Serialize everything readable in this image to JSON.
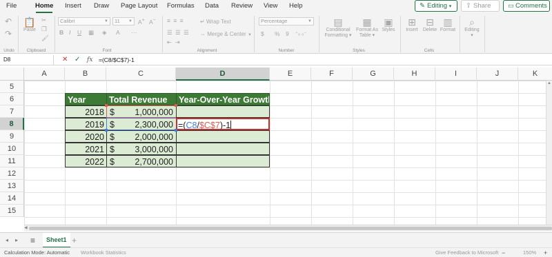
{
  "menu": {
    "items": [
      "File",
      "Home",
      "Insert",
      "Draw",
      "Page Layout",
      "Formulas",
      "Data",
      "Review",
      "View",
      "Help"
    ],
    "active": "Home",
    "editing_label": "Editing",
    "share_label": "Share",
    "comments_label": "Comments"
  },
  "ribbon": {
    "undo_label": "Undo",
    "clipboard": {
      "paste_label": "Paste",
      "group_label": "Clipboard"
    },
    "font": {
      "name": "Calibri",
      "size": "11",
      "group_label": "Font"
    },
    "alignment": {
      "wrap_label": "Wrap Text",
      "merge_label": "Merge & Center",
      "group_label": "Alignment"
    },
    "number": {
      "format": "Percentage",
      "group_label": "Number",
      "symbols": [
        "$",
        "%",
        "9"
      ]
    },
    "styles": {
      "conditional_label": "Conditional",
      "conditional_label2": "Formatting",
      "format_table_label": "Format As",
      "format_table_label2": "Table",
      "styles_label": "Styles",
      "group_label": "Styles"
    },
    "cells": {
      "insert_label": "Insert",
      "delete_label": "Delete",
      "format_label": "Format",
      "group_label": "Cells"
    },
    "editing": {
      "label": "Editing"
    }
  },
  "formula_bar": {
    "name_box": "D8",
    "fx_label": "fx",
    "formula": "=(C8/$C$7)-1"
  },
  "columns": [
    "A",
    "B",
    "C",
    "D",
    "E",
    "F",
    "G",
    "H",
    "I",
    "J",
    "K"
  ],
  "selected_column": "D",
  "rows": [
    "5",
    "6",
    "7",
    "8",
    "9",
    "10",
    "11",
    "12",
    "13",
    "14",
    "15"
  ],
  "selected_row": "8",
  "table": {
    "headers": [
      "Year",
      "Total Revenue",
      "Year-Over-Year Growth"
    ],
    "currency_symbol": "$",
    "data": [
      {
        "year": "2018",
        "revenue": "1,000,000"
      },
      {
        "year": "2019",
        "revenue": "2,300,000"
      },
      {
        "year": "2020",
        "revenue": "2,000,000"
      },
      {
        "year": "2021",
        "revenue": "3,000,000"
      },
      {
        "year": "2022",
        "revenue": "2,700,000"
      }
    ],
    "editing_cell": {
      "prefix": "=(",
      "ref1": "C8",
      "slash": "/",
      "ref2": "$C$7",
      "suffix": ")-1"
    }
  },
  "sheets": {
    "active": "Sheet1",
    "add_label": "+"
  },
  "status": {
    "calc_mode": "Calculation Mode: Automatic",
    "workbook_stats": "Workbook Statistics",
    "feedback": "Give Feedback to Microsoft",
    "zoom": "150%",
    "zoom_minus": "−",
    "zoom_plus": "+"
  },
  "colors": {
    "accent": "#217346",
    "header_fill": "#3d7a35",
    "table_fill": "#dcebd3",
    "active_border": "#c4312b",
    "ref_blue": "#3e7fd8",
    "ref_red": "#e05a52"
  }
}
